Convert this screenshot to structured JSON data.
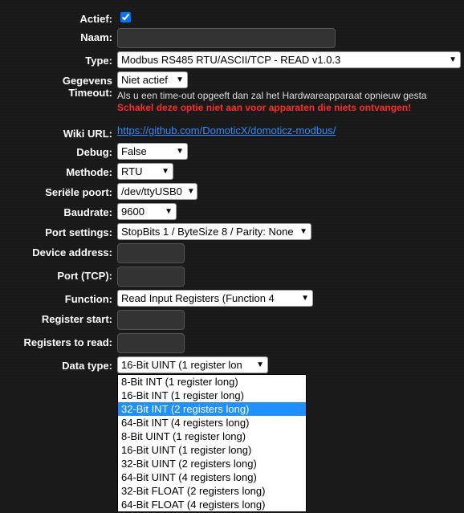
{
  "labels": {
    "actief": "Actief:",
    "naam": "Naam:",
    "type": "Type:",
    "gegevens_timeout_l1": "Gegevens",
    "gegevens_timeout_l2": "Timeout:",
    "wiki": "Wiki URL:",
    "debug": "Debug:",
    "methode": "Methode:",
    "seriele": "Seriële poort:",
    "baud": "Baudrate:",
    "port_settings": "Port settings:",
    "device_addr": "Device address:",
    "port_tcp": "Port (TCP):",
    "function": "Function:",
    "reg_start": "Register start:",
    "reg_read": "Registers to read:",
    "data_type": "Data type:"
  },
  "values": {
    "actief_checked": true,
    "naam": "",
    "type": "Modbus RS485 RTU/ASCII/TCP - READ v1.0.3",
    "gegevens_timeout": "Niet actief",
    "timeout_note": "Als u een time-out opgeeft dan zal het Hardwareapparaat opnieuw gesta",
    "timeout_warn": "Schakel deze optie niet aan voor apparaten die niets ontvangen!",
    "wiki_url": "https://github.com/DomoticX/domoticz-modbus/",
    "debug": "False",
    "methode": "RTU",
    "seriele": "/dev/ttyUSB0",
    "baud": "9600",
    "port_settings": "StopBits 1 / ByteSize 8 / Parity: None",
    "device_addr": "",
    "port_tcp": "",
    "function": "Read Input Registers (Function 4",
    "reg_start": "",
    "reg_read": "",
    "data_type_selected": "16-Bit UINT (1 register lon"
  },
  "data_type_options": [
    {
      "label": "8-Bit INT (1 register long)",
      "selected": false
    },
    {
      "label": "16-Bit INT (1 register long)",
      "selected": false
    },
    {
      "label": "32-Bit INT (2 registers long)",
      "selected": true
    },
    {
      "label": "64-Bit INT (4 registers long)",
      "selected": false
    },
    {
      "label": "8-Bit UINT (1 register long)",
      "selected": false
    },
    {
      "label": "16-Bit UINT (1 register long)",
      "selected": false
    },
    {
      "label": "32-Bit UINT (2 registers long)",
      "selected": false
    },
    {
      "label": "64-Bit UINT (4 registers long)",
      "selected": false
    },
    {
      "label": "32-Bit FLOAT (2 registers long)",
      "selected": false
    },
    {
      "label": "64-Bit FLOAT (4 registers long)",
      "selected": false
    }
  ]
}
